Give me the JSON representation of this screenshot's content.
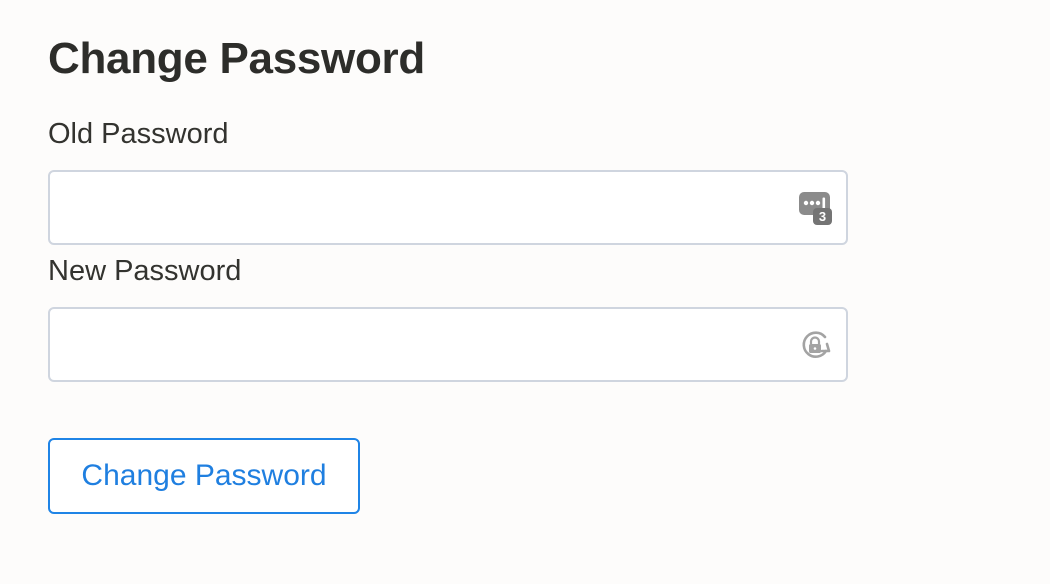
{
  "page": {
    "title": "Change Password"
  },
  "form": {
    "old_password": {
      "label": "Old Password",
      "value": "",
      "placeholder": "",
      "icon": "password-manager-key-icon"
    },
    "new_password": {
      "label": "New Password",
      "value": "",
      "placeholder": "",
      "icon": "generate-password-icon"
    },
    "submit_label": "Change Password"
  },
  "colors": {
    "background": "#fdfcfb",
    "text": "#2f2f2c",
    "input_border": "#cfd5df",
    "accent": "#1f84e6",
    "icon_gray": "#8d8d8d"
  }
}
